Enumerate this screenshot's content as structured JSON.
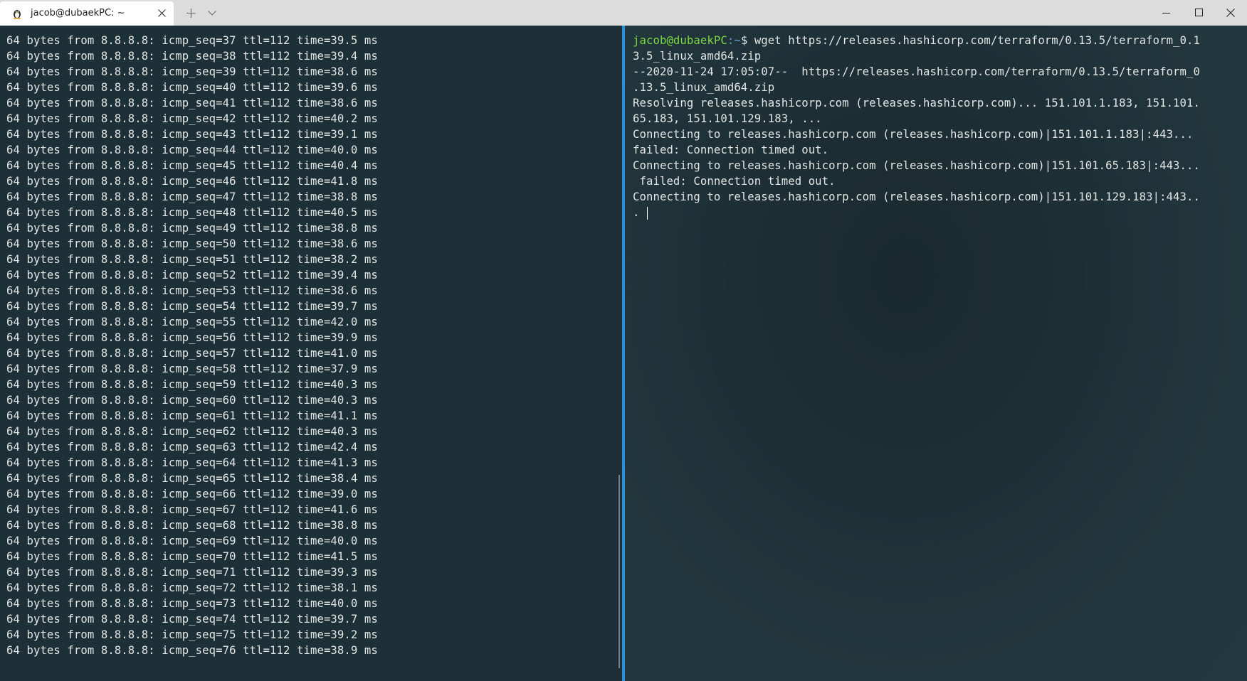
{
  "window": {
    "tab_title": "jacob@dubaekPC: ~",
    "icons": {
      "tab": "linux-penguin-icon",
      "tab_close": "close-icon",
      "new_tab": "plus-icon",
      "dropdown": "chevron-down-icon",
      "minimize": "minimize-icon",
      "maximize": "maximize-icon",
      "close": "close-icon"
    }
  },
  "colors": {
    "accent_divider": "#2a8fd4",
    "prompt_user": "#7fd843",
    "prompt_path": "#6b9fd6"
  },
  "left_pane": {
    "lines": [
      "64 bytes from 8.8.8.8: icmp_seq=37 ttl=112 time=39.5 ms",
      "64 bytes from 8.8.8.8: icmp_seq=38 ttl=112 time=39.4 ms",
      "64 bytes from 8.8.8.8: icmp_seq=39 ttl=112 time=38.6 ms",
      "64 bytes from 8.8.8.8: icmp_seq=40 ttl=112 time=39.6 ms",
      "64 bytes from 8.8.8.8: icmp_seq=41 ttl=112 time=38.6 ms",
      "64 bytes from 8.8.8.8: icmp_seq=42 ttl=112 time=40.2 ms",
      "64 bytes from 8.8.8.8: icmp_seq=43 ttl=112 time=39.1 ms",
      "64 bytes from 8.8.8.8: icmp_seq=44 ttl=112 time=40.0 ms",
      "64 bytes from 8.8.8.8: icmp_seq=45 ttl=112 time=40.4 ms",
      "64 bytes from 8.8.8.8: icmp_seq=46 ttl=112 time=41.8 ms",
      "64 bytes from 8.8.8.8: icmp_seq=47 ttl=112 time=38.8 ms",
      "64 bytes from 8.8.8.8: icmp_seq=48 ttl=112 time=40.5 ms",
      "64 bytes from 8.8.8.8: icmp_seq=49 ttl=112 time=38.8 ms",
      "64 bytes from 8.8.8.8: icmp_seq=50 ttl=112 time=38.6 ms",
      "64 bytes from 8.8.8.8: icmp_seq=51 ttl=112 time=38.2 ms",
      "64 bytes from 8.8.8.8: icmp_seq=52 ttl=112 time=39.4 ms",
      "64 bytes from 8.8.8.8: icmp_seq=53 ttl=112 time=38.6 ms",
      "64 bytes from 8.8.8.8: icmp_seq=54 ttl=112 time=39.7 ms",
      "64 bytes from 8.8.8.8: icmp_seq=55 ttl=112 time=42.0 ms",
      "64 bytes from 8.8.8.8: icmp_seq=56 ttl=112 time=39.9 ms",
      "64 bytes from 8.8.8.8: icmp_seq=57 ttl=112 time=41.0 ms",
      "64 bytes from 8.8.8.8: icmp_seq=58 ttl=112 time=37.9 ms",
      "64 bytes from 8.8.8.8: icmp_seq=59 ttl=112 time=40.3 ms",
      "64 bytes from 8.8.8.8: icmp_seq=60 ttl=112 time=40.3 ms",
      "64 bytes from 8.8.8.8: icmp_seq=61 ttl=112 time=41.1 ms",
      "64 bytes from 8.8.8.8: icmp_seq=62 ttl=112 time=40.3 ms",
      "64 bytes from 8.8.8.8: icmp_seq=63 ttl=112 time=42.4 ms",
      "64 bytes from 8.8.8.8: icmp_seq=64 ttl=112 time=41.3 ms",
      "64 bytes from 8.8.8.8: icmp_seq=65 ttl=112 time=38.4 ms",
      "64 bytes from 8.8.8.8: icmp_seq=66 ttl=112 time=39.0 ms",
      "64 bytes from 8.8.8.8: icmp_seq=67 ttl=112 time=41.6 ms",
      "64 bytes from 8.8.8.8: icmp_seq=68 ttl=112 time=38.8 ms",
      "64 bytes from 8.8.8.8: icmp_seq=69 ttl=112 time=40.0 ms",
      "64 bytes from 8.8.8.8: icmp_seq=70 ttl=112 time=41.5 ms",
      "64 bytes from 8.8.8.8: icmp_seq=71 ttl=112 time=39.3 ms",
      "64 bytes from 8.8.8.8: icmp_seq=72 ttl=112 time=38.1 ms",
      "64 bytes from 8.8.8.8: icmp_seq=73 ttl=112 time=40.0 ms",
      "64 bytes from 8.8.8.8: icmp_seq=74 ttl=112 time=39.7 ms",
      "64 bytes from 8.8.8.8: icmp_seq=75 ttl=112 time=39.2 ms",
      "64 bytes from 8.8.8.8: icmp_seq=76 ttl=112 time=38.9 ms"
    ]
  },
  "right_pane": {
    "prompt_user_host": "jacob@dubaekPC",
    "prompt_path": ":~",
    "prompt_symbol": "$ ",
    "command_line_1": "wget https://releases.hashicorp.com/terraform/0.13.5/terraform_0.1",
    "output_lines": [
      "3.5_linux_amd64.zip",
      "--2020-11-24 17:05:07--  https://releases.hashicorp.com/terraform/0.13.5/terraform_0",
      ".13.5_linux_amd64.zip",
      "Resolving releases.hashicorp.com (releases.hashicorp.com)... 151.101.1.183, 151.101.",
      "65.183, 151.101.129.183, ...",
      "Connecting to releases.hashicorp.com (releases.hashicorp.com)|151.101.1.183|:443...",
      "failed: Connection timed out.",
      "Connecting to releases.hashicorp.com (releases.hashicorp.com)|151.101.65.183|:443...",
      " failed: Connection timed out.",
      "Connecting to releases.hashicorp.com (releases.hashicorp.com)|151.101.129.183|:443.."
    ],
    "last_line": "."
  }
}
